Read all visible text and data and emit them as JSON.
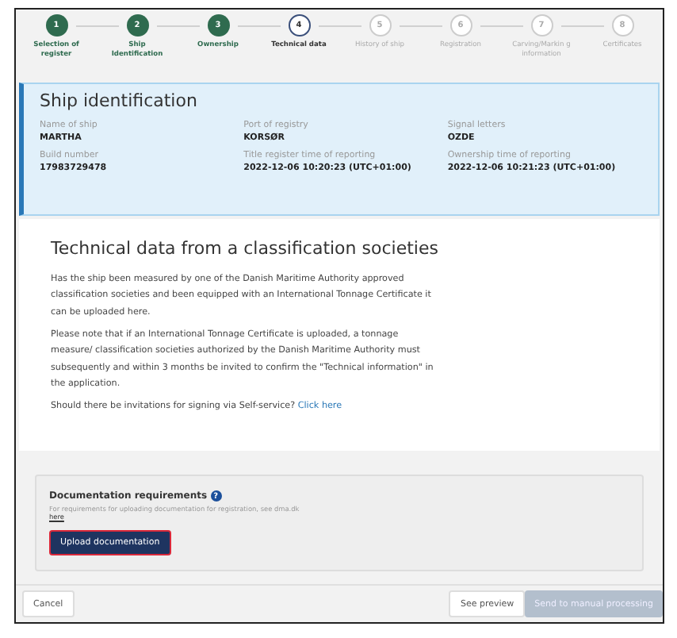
{
  "steps": [
    {
      "number": "1",
      "label": "Selection of register",
      "completed": true,
      "selected": false
    },
    {
      "number": "2",
      "label": "Ship Identification",
      "completed": true,
      "selected": false
    },
    {
      "number": "3",
      "label": "Ownership",
      "completed": true,
      "selected": false
    },
    {
      "number": "4",
      "label": "Technical data",
      "completed": false,
      "selected": true
    },
    {
      "number": "5",
      "label": "History of ship",
      "completed": false,
      "selected": false
    },
    {
      "number": "6",
      "label": "Registration",
      "completed": false,
      "selected": false
    },
    {
      "number": "7",
      "label": "Carving/Markin g information",
      "completed": false,
      "selected": false
    },
    {
      "number": "8",
      "label": "Certificates",
      "completed": false,
      "selected": false
    }
  ],
  "ship_card": {
    "title": "Ship identification",
    "fields": [
      {
        "label": "Name of ship",
        "value": "MARTHA"
      },
      {
        "label": "Port of registry",
        "value": "KORSØR"
      },
      {
        "label": "Signal letters",
        "value": "OZDE"
      },
      {
        "label": "Build number",
        "value": "17983729478"
      },
      {
        "label": "Title register time of reporting",
        "value": "2022-12-06 10:20:23 (UTC+01:00)"
      },
      {
        "label": "Ownership time of reporting",
        "value": "2022-12-06 10:21:23 (UTC+01:00)"
      }
    ]
  },
  "section": {
    "title": "Technical data from a classification societies",
    "paragraphs": [
      "Has the ship been measured by one of the Danish Maritime Authority approved classification societies and been equipped with an International Tonnage Certificate it can be uploaded here.",
      "Please note that if an International Tonnage Certificate is uploaded, a tonnage measure/ classification societies authorized by the Danish Maritime Authority must subsequently and within 3 months be invited to confirm the \"Technical information\" in the application."
    ],
    "question": "Should there be invitations for signing via Self-service?",
    "question_link": "Click here"
  },
  "documentation": {
    "title": "Documentation requirements",
    "help_icon": "?",
    "hint": "For requirements for uploading documentation for registration, see dma.dk",
    "hint_link": "here",
    "button": "Upload documentation"
  },
  "footer": {
    "cancel": "Cancel",
    "preview": "See preview",
    "submit": {
      "label": "Send to manual processing",
      "disabled": true
    }
  }
}
